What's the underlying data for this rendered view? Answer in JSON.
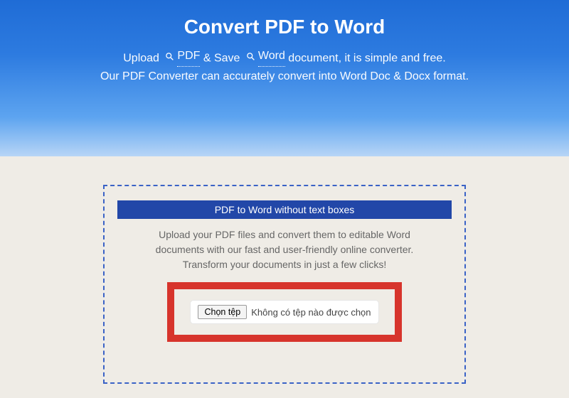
{
  "hero": {
    "title": "Convert PDF to Word",
    "line1_prefix": "Upload",
    "line1_link1": "PDF",
    "line1_mid": "& Save",
    "line1_link2": "Word",
    "line1_suffix": "document, it is simple and free.",
    "line2": "Our PDF Converter can accurately convert into Word Doc & Docx format."
  },
  "card": {
    "header": "PDF to Word without text boxes",
    "desc_line1": "Upload your PDF files and convert them to editable Word",
    "desc_line2": "documents with our fast and user-friendly online converter.",
    "desc_line3": "Transform your documents in just a few clicks!"
  },
  "filepicker": {
    "button": "Chọn tệp",
    "status": "Không có tệp nào được chọn"
  },
  "colors": {
    "highlight": "#d7342c",
    "primary": "#2247a8"
  }
}
